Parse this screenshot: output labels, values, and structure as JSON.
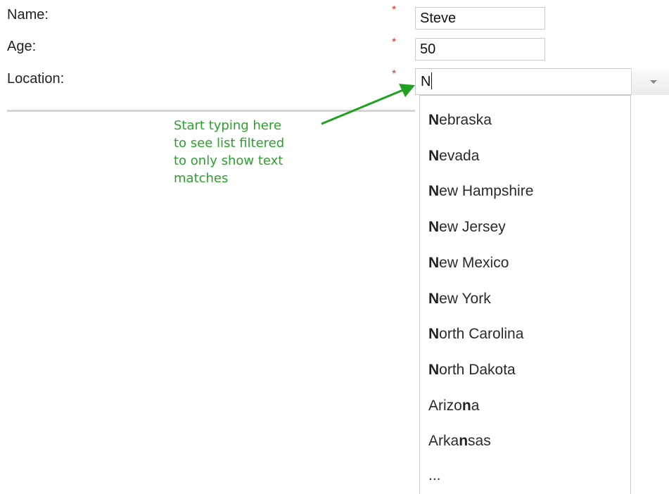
{
  "form": {
    "name_label": "Name:",
    "age_label": "Age:",
    "location_label": "Location:",
    "required_marker": "*",
    "name_value": "Steve",
    "age_value": "50",
    "location_value": "N"
  },
  "dropdown": {
    "options": [
      {
        "pre": "",
        "bold": "N",
        "post": "ebraska"
      },
      {
        "pre": "",
        "bold": "N",
        "post": "evada"
      },
      {
        "pre": "",
        "bold": "N",
        "post": "ew Hampshire"
      },
      {
        "pre": "",
        "bold": "N",
        "post": "ew Jersey"
      },
      {
        "pre": "",
        "bold": "N",
        "post": "ew Mexico"
      },
      {
        "pre": "",
        "bold": "N",
        "post": "ew York"
      },
      {
        "pre": "",
        "bold": "N",
        "post": "orth Carolina"
      },
      {
        "pre": "",
        "bold": "N",
        "post": "orth Dakota"
      },
      {
        "pre": "Arizo",
        "bold": "n",
        "post": "a"
      },
      {
        "pre": "Arka",
        "bold": "n",
        "post": "sas"
      }
    ],
    "more": "..."
  },
  "annotation": {
    "lines": [
      "Start typing here",
      "to see list filtered",
      "to only show text",
      "matches"
    ],
    "color": "#2ea02e"
  },
  "colors": {
    "required": "#dd3333",
    "border": "#c9c9c9"
  }
}
